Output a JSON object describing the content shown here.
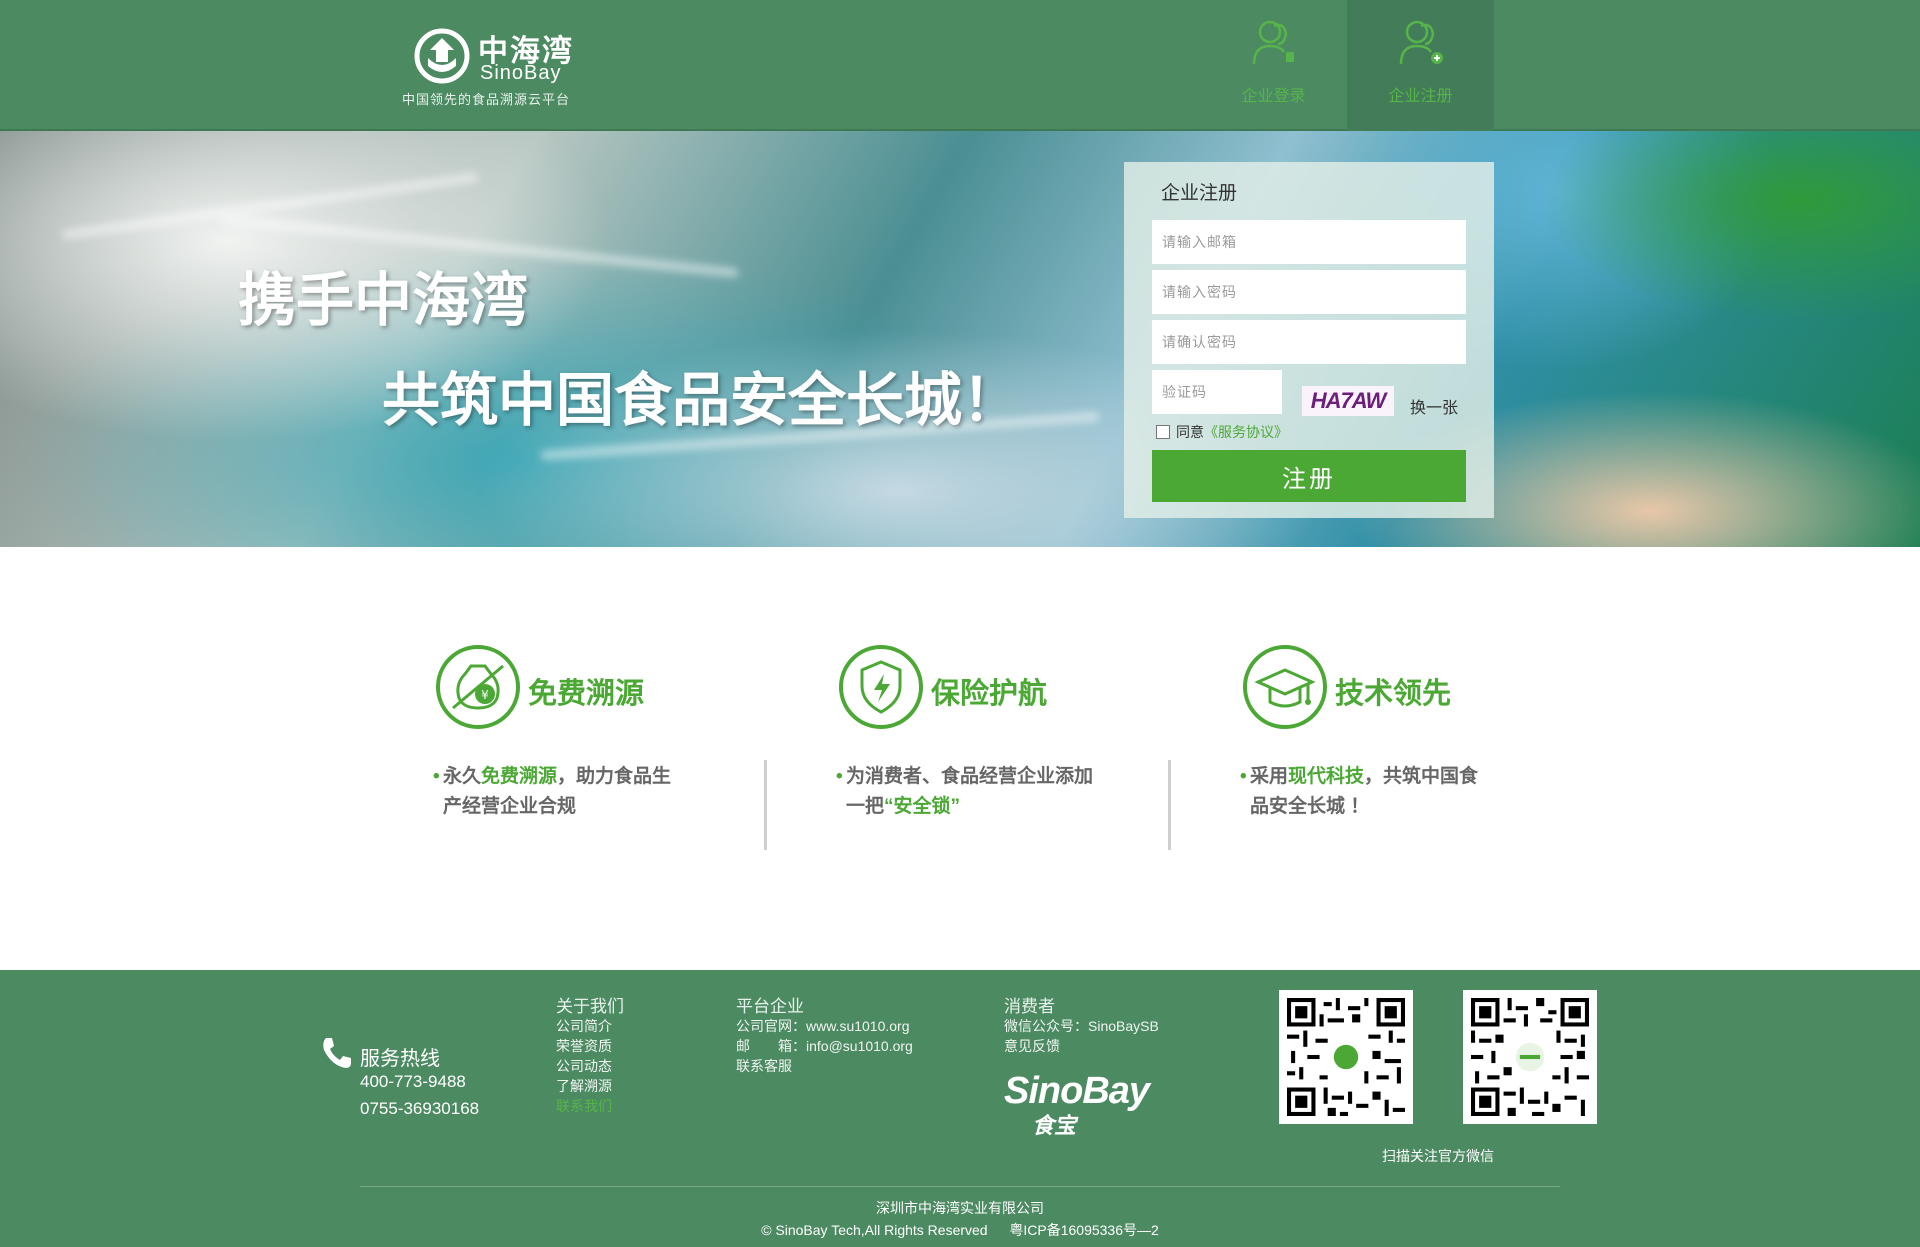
{
  "header": {
    "logo_cn": "中海湾",
    "logo_en": "SinoBay",
    "logo_tagline": "中国领先的食品溯源云平台",
    "nav": [
      {
        "label": "企业登录",
        "active": false
      },
      {
        "label": "企业注册",
        "active": true
      }
    ]
  },
  "banner": {
    "slogan_line1": "携手中海湾",
    "slogan_line2": "共筑中国食品安全长城！"
  },
  "register": {
    "title": "企业注册",
    "email_placeholder": "请输入邮箱",
    "password_placeholder": "请输入密码",
    "confirm_placeholder": "请确认密码",
    "captcha_placeholder": "验证码",
    "captcha_text": "HA7AW",
    "captcha_refresh": "换一张",
    "agree_prefix": "同意",
    "agree_link": "《服务协议》",
    "submit_label": "注册"
  },
  "features": [
    {
      "title": "免费溯源",
      "icon": "money-bag-icon",
      "desc_before": "永久",
      "desc_highlight": "免费溯源",
      "desc_after": "，助力食品生产经营企业合规"
    },
    {
      "title": "保险护航",
      "icon": "shield-bolt-icon",
      "desc_before": "为消费者、食品经营企业添加一把",
      "desc_highlight": "“安全锁”",
      "desc_after": ""
    },
    {
      "title": "技术领先",
      "icon": "graduation-cap-icon",
      "desc_before": "采用",
      "desc_highlight": "现代科技",
      "desc_after": "，共筑中国食品安全长城 ！"
    }
  ],
  "footer": {
    "hotline_title": "服务热线",
    "hotline_numbers": [
      "400-773-9488",
      "0755-36930168"
    ],
    "about": {
      "title": "关于我们",
      "items": [
        "公司简介",
        "荣誉资质",
        "公司动态",
        "了解溯源",
        "联系我们"
      ]
    },
    "platform": {
      "title": "平台企业",
      "items": [
        "公司官网：www.su1010.org",
        "邮　　箱：info@su1010.org",
        "联系客服"
      ]
    },
    "consumer": {
      "title": "消费者",
      "items": [
        "微信公众号：SinoBaySB",
        "意见反馈"
      ]
    },
    "brand_logo_en": "SinoBay",
    "brand_logo_cn": "食宝",
    "qr_caption": "扫描关注官方微信",
    "company": "深圳市中海湾实业有限公司",
    "copyright": "© SinoBay Tech,All Rights Reserved",
    "icp": "粤ICP备16095336号—2"
  },
  "colors": {
    "brand_green": "#4c8a62",
    "accent_green": "#4ca835"
  }
}
